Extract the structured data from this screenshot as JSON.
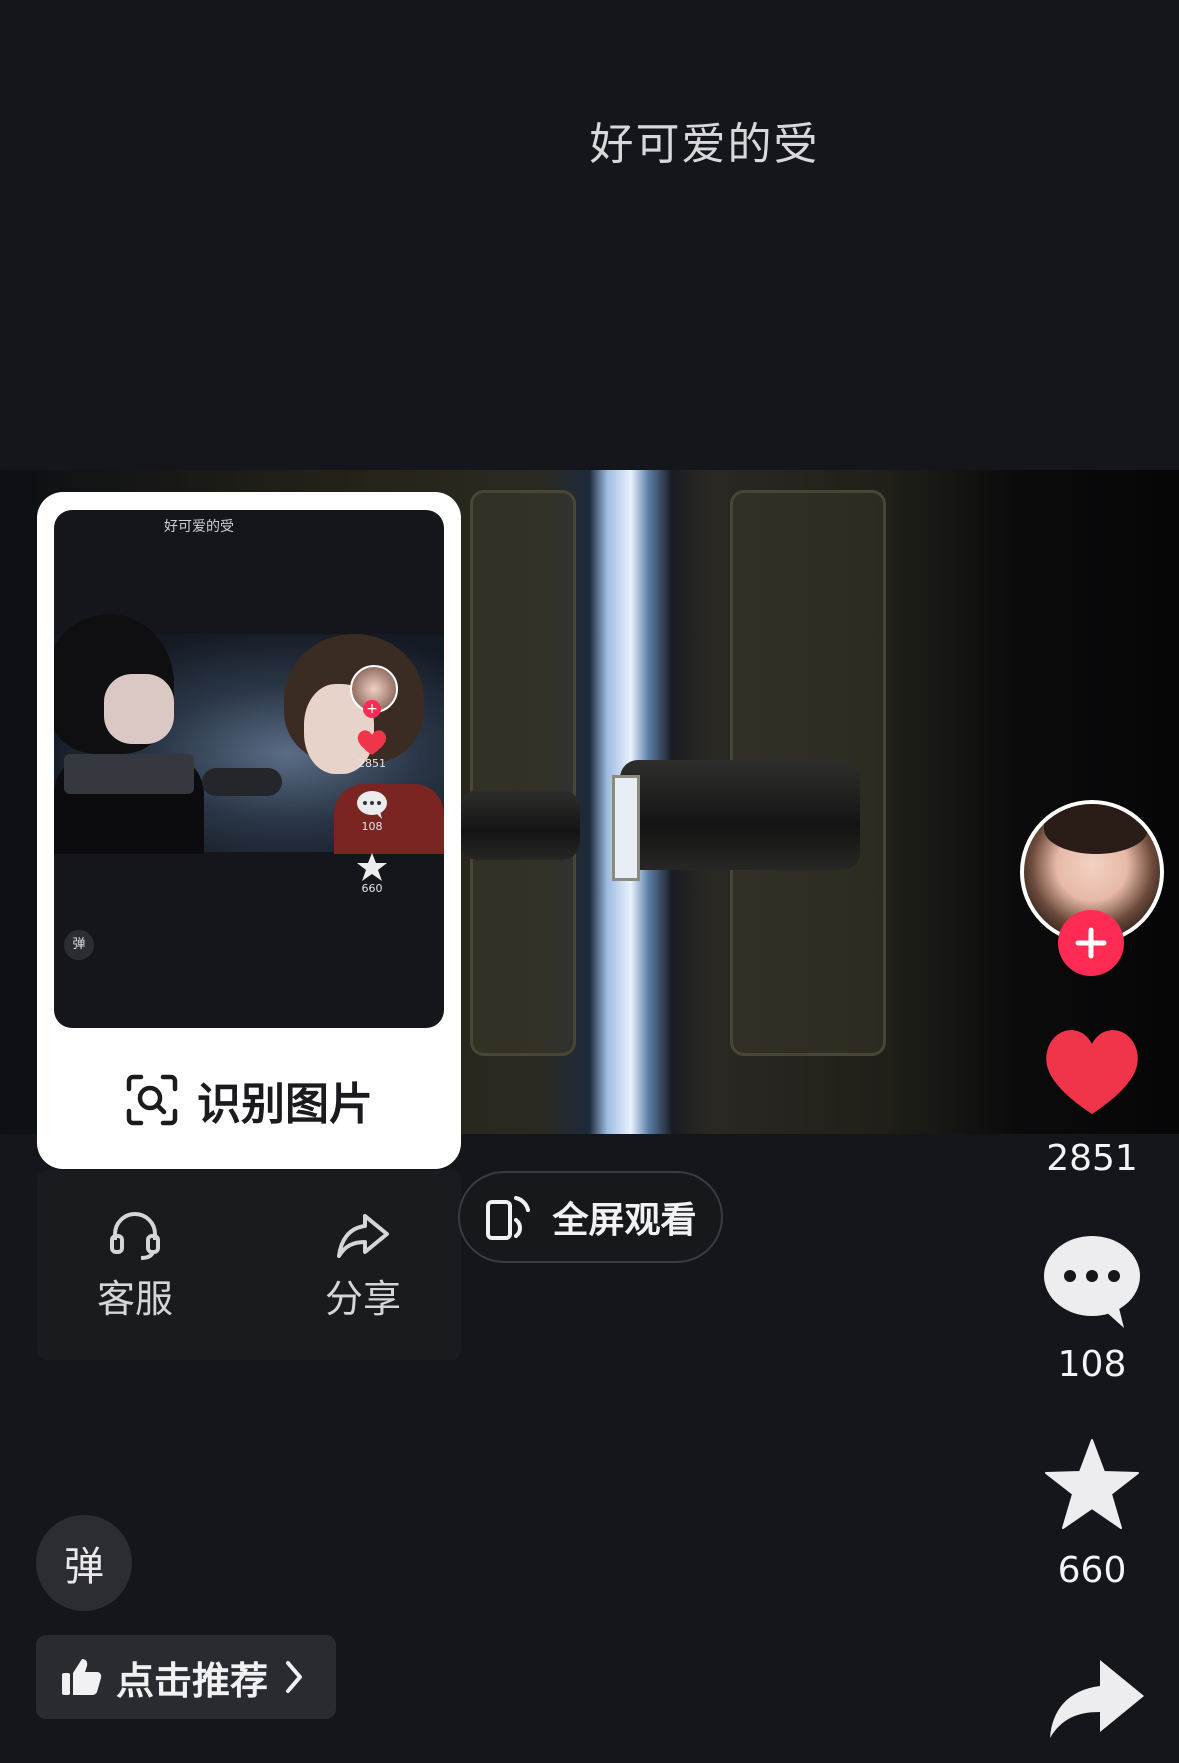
{
  "caption": "好可爱的受",
  "popup": {
    "thumbnail": {
      "caption": "好可爱的受",
      "like_count": "2851",
      "comment_count": "108",
      "favorite_count": "660",
      "danmu_label": "弹"
    },
    "recognize_label": "识别图片"
  },
  "menu": {
    "customer_service_label": "客服",
    "share_label": "分享"
  },
  "fullscreen_label": "全屏观看",
  "rail": {
    "like_count": "2851",
    "comment_count": "108",
    "favorite_count": "660"
  },
  "danmu_label": "弹",
  "recommend_label": "点击推荐",
  "colors": {
    "background": "#15161b",
    "like_red": "#fe2c55",
    "heart_red": "#f0354b"
  }
}
